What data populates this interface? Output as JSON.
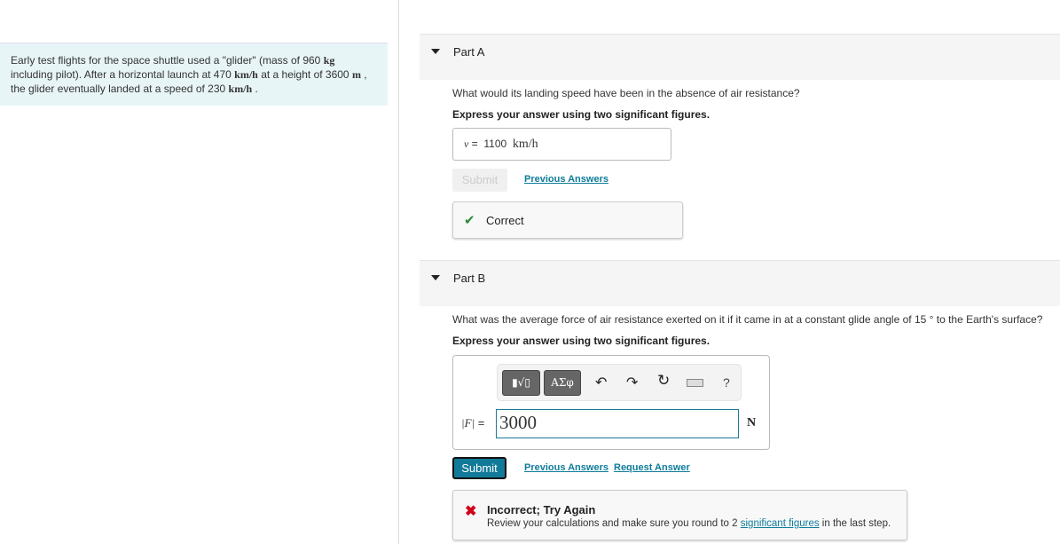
{
  "problem": {
    "t1": "Early test flights for the space shuttle used a \"glider\" (mass of 960 ",
    "u1": "kg",
    "t2": " including pilot). After a horizontal launch at 470 ",
    "u2": "km/h",
    "t3": " at a height of 3600 ",
    "u3": "m",
    "t4": " , the glider eventually landed at a speed of 230 ",
    "u4": "km/h",
    "t5": " ."
  },
  "partA": {
    "label": "Part A",
    "question": "What would its landing speed have been in the absence of air resistance?",
    "instruction": "Express your answer using two significant figures.",
    "var": "v",
    "eq": "=",
    "value": "1100",
    "unit": "km/h",
    "submit": "Submit",
    "previous": "Previous Answers",
    "feedback": "Correct"
  },
  "partB": {
    "label": "Part B",
    "question": "What was the average force of air resistance exerted on it if it came in at a constant glide angle of 15 ° to the Earth's surface?",
    "instruction": "Express your answer using two significant figures.",
    "toolbar": {
      "templates": "▮√▯",
      "greek": "ΑΣφ",
      "help": "?"
    },
    "var": "|F|",
    "eq": "=",
    "value": "3000",
    "unit": "N",
    "submit": "Submit",
    "previous": "Previous Answers",
    "request": "Request Answer",
    "feedback_title": "Incorrect; Try Again",
    "feedback_pre": "Review your calculations and make sure you round to 2 ",
    "feedback_link": "significant figures",
    "feedback_post": " in the last step."
  },
  "colors": {
    "accent": "#127a99",
    "correct": "#2a8a3a",
    "incorrect": "#d0021b",
    "problem_bg": "#e8f5f7"
  }
}
